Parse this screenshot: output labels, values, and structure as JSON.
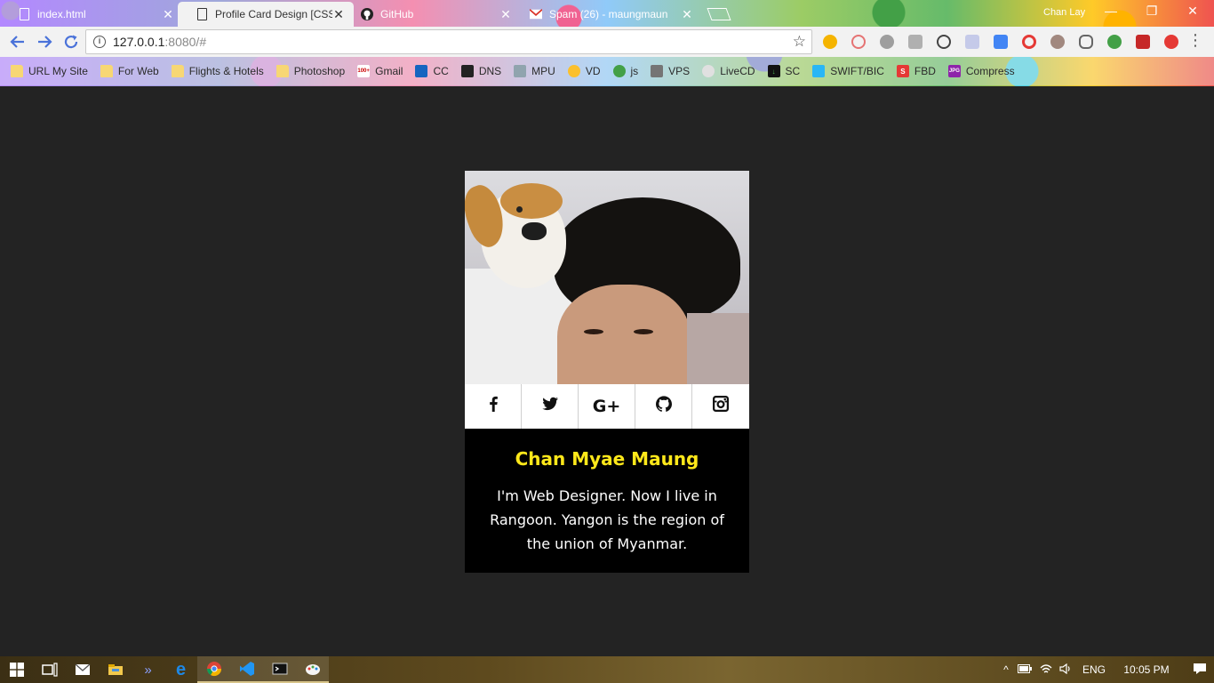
{
  "browser": {
    "tabs": [
      {
        "title": "index.html",
        "active": false,
        "favicon": "document-icon"
      },
      {
        "title": "Profile Card Design [CSS]",
        "active": true,
        "favicon": "document-icon"
      },
      {
        "title": "GitHub",
        "active": false,
        "favicon": "github-icon"
      },
      {
        "title": "Spam (26) - maungmaun",
        "active": false,
        "favicon": "gmail-icon"
      }
    ],
    "user": "Chan Lay",
    "url_host": "127.0.0.1",
    "url_rest": ":8080/#",
    "bookmarks": [
      {
        "label": "URL My Site",
        "icon": "folder-icon"
      },
      {
        "label": "For Web",
        "icon": "folder-icon"
      },
      {
        "label": "Flights & Hotels",
        "icon": "folder-icon"
      },
      {
        "label": "Photoshop",
        "icon": "folder-icon"
      },
      {
        "label": "Gmail",
        "icon": "gmail-icon"
      },
      {
        "label": "CC",
        "icon": "cc-icon"
      },
      {
        "label": "DNS",
        "icon": "dns-icon"
      },
      {
        "label": "MPU",
        "icon": "mpu-icon"
      },
      {
        "label": "VD",
        "icon": "vd-icon"
      },
      {
        "label": "js",
        "icon": "js-icon"
      },
      {
        "label": "VPS",
        "icon": "vps-icon"
      },
      {
        "label": "LiveCD",
        "icon": "livecd-icon"
      },
      {
        "label": "SC",
        "icon": "download-icon"
      },
      {
        "label": "SWIFT/BIC",
        "icon": "swift-icon"
      },
      {
        "label": "FBD",
        "icon": "fbd-icon"
      },
      {
        "label": "Compress",
        "icon": "jpg-icon"
      }
    ],
    "gmail_badge": "100+",
    "jpg_badge": "JPG"
  },
  "card": {
    "name": "Chan Myae Maung",
    "bio": "I'm Web Designer. Now I live in Rangoon. Yangon is the region of the union of Myanmar.",
    "social": [
      "facebook-icon",
      "twitter-icon",
      "google-plus-icon",
      "github-icon",
      "instagram-icon"
    ],
    "name_color": "#ffe81a"
  },
  "taskbar": {
    "language": "ENG",
    "time": "10:05 PM"
  }
}
